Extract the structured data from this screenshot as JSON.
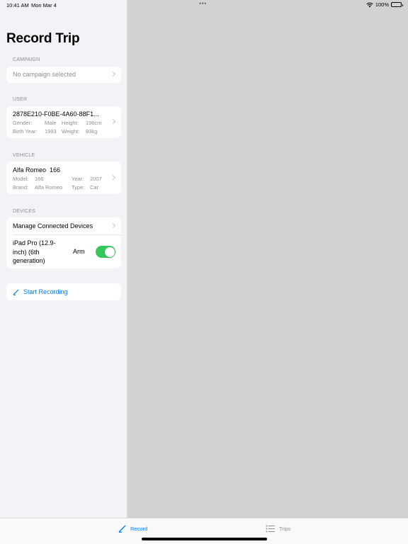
{
  "status_bar": {
    "time": "10:41 AM",
    "date": "Mon Mar 4",
    "battery": "100%"
  },
  "page": {
    "title": "Record Trip"
  },
  "campaign": {
    "header": "CAMPAIGN",
    "value": "No campaign selected"
  },
  "user": {
    "header": "USER",
    "id": "2878E210-F0BE-4A60-88F1...",
    "gender_label": "Gender:",
    "gender": "Male",
    "height_label": "Height:",
    "height": "196cm",
    "birth_year_label": "Birth Year:",
    "birth_year": "1993",
    "weight_label": "Weight:",
    "weight": "93kg"
  },
  "vehicle": {
    "header": "VEHICLE",
    "name": "Alfa Romeo  166",
    "model_label": "Model:",
    "model": "166",
    "year_label": "Year:",
    "year": "2007",
    "brand_label": "Brand:",
    "brand": "Alfa Romeo",
    "type_label": "Type:",
    "type": "Car"
  },
  "devices": {
    "header": "DEVICES",
    "manage_label": "Manage Connected Devices",
    "device_name": "iPad Pro (12.9-inch) (6th generation)",
    "arm_label": "Arm",
    "arm_on": true
  },
  "actions": {
    "start_recording": "Start Recording"
  },
  "tabbar": {
    "tabs": [
      {
        "label": "Record",
        "icon": "pencil-icon",
        "selected": true
      },
      {
        "label": "Trips",
        "icon": "list-icon",
        "selected": false
      }
    ]
  },
  "colors": {
    "accent": "#007aff",
    "toggle_on": "#34c759",
    "sidebar_bg": "#f2f2f7",
    "detail_bg": "#d2d2d2"
  }
}
